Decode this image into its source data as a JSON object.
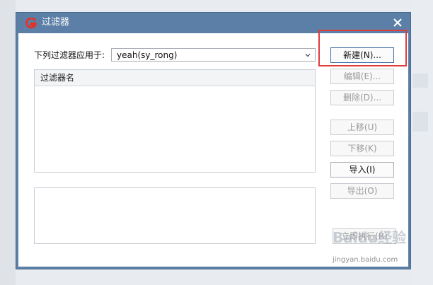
{
  "window": {
    "title": "过滤器",
    "close_label": "×"
  },
  "apply_to": {
    "label": "下列过滤器应用于:",
    "selected_account": "yeah(sy_rong)"
  },
  "filter_list": {
    "column_header": "过滤器名",
    "rows": []
  },
  "buttons": {
    "new": "新建(N)...",
    "edit": "编辑(E)...",
    "delete": "删除(D)...",
    "move_up": "上移(U)",
    "move_down": "下移(K)",
    "import": "导入(I)",
    "export": "导出(O)",
    "run_now": "立即执行(R)"
  },
  "watermark": {
    "brand": "Baidu经验",
    "url": "jingyan.baidu.com"
  },
  "colors": {
    "titlebar": "#5b7fa6",
    "highlight": "#e23b3b",
    "logo": "#e0342b"
  }
}
